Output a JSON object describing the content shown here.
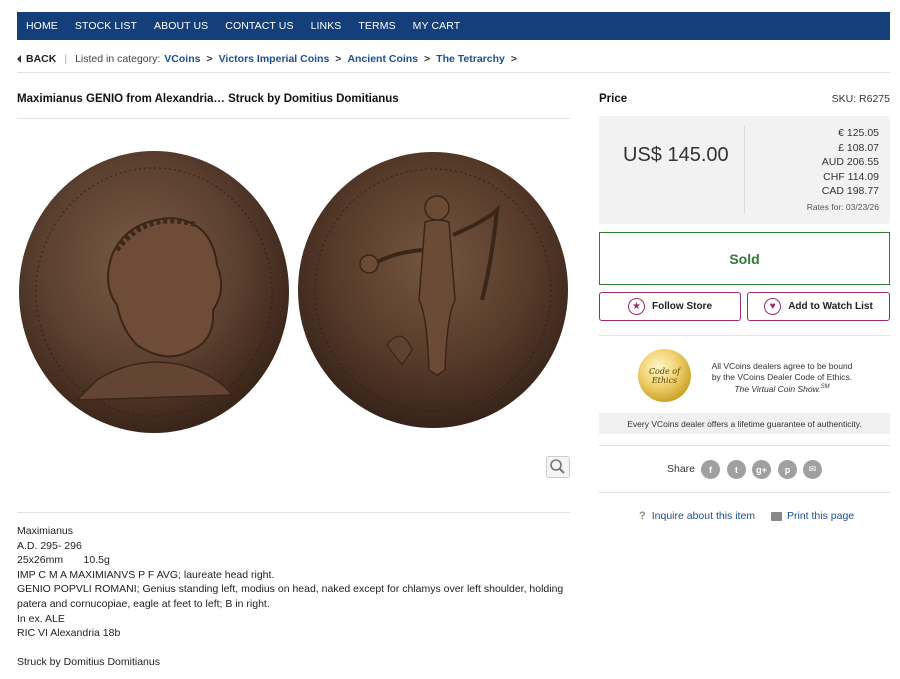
{
  "nav": [
    "HOME",
    "STOCK LIST",
    "ABOUT US",
    "CONTACT US",
    "LINKS",
    "TERMS",
    "MY CART"
  ],
  "breadcrumb": {
    "back": "BACK",
    "listed_in": "Listed in category:",
    "items": [
      "VCoins",
      "Victors Imperial Coins",
      "Ancient Coins",
      "The Tetrarchy"
    ]
  },
  "product": {
    "title": "Maximianus GENIO from Alexandria… Struck by Domitius Domitianus",
    "coin_colors": {
      "bronze": "#6b4a34",
      "field": "#5c3f2c"
    },
    "description": [
      "Maximianus",
      "A.D. 295- 296",
      "25x26mm       10.5g",
      "IMP C M A MAXIMIANVS P F AVG; laureate head right.",
      "GENIO POPVLI ROMANI; Genius standing left, modius on head, naked except for chlamys over left shoulder, holding patera and cornucopiae, eagle at feet to left; B in right.",
      "In ex. ALE",
      "RIC VI Alexandria 18b"
    ],
    "struck_by": "Struck by Domitius Domitianus"
  },
  "price": {
    "label": "Price",
    "sku": "SKU: R6275",
    "main": "US$ 145.00",
    "conversions": [
      "€ 125.05",
      "£ 108.07",
      "AUD 206.55",
      "CHF 114.09",
      "CAD 198.77"
    ],
    "rates_for": "Rates for: 03/23/26"
  },
  "status": "Sold",
  "actions": {
    "follow": "Follow Store",
    "watch": "Add to Watch List"
  },
  "ethics": {
    "seal_line1": "Code of",
    "seal_line2": "Ethics",
    "text": "All VCoins dealers agree to be bound by the VCoins Dealer Code of Ethics.",
    "show": "The Virtual Coin Show.",
    "show_mark": "SM",
    "guarantee": "Every VCoins dealer offers a lifetime guarantee of authenticity."
  },
  "share": {
    "label": "Share",
    "icons": [
      "facebook-icon",
      "twitter-icon",
      "google-plus-icon",
      "pinterest-icon",
      "email-icon"
    ],
    "glyphs": [
      "f",
      "t",
      "g+",
      "p",
      "✉"
    ]
  },
  "links": {
    "inquire": "Inquire about this item",
    "print": "Print this page"
  },
  "colors": {
    "nav_bg": "#143f7a",
    "link": "#1b4f91",
    "sold": "#2e7d32",
    "accent": "#9b2a6d"
  }
}
